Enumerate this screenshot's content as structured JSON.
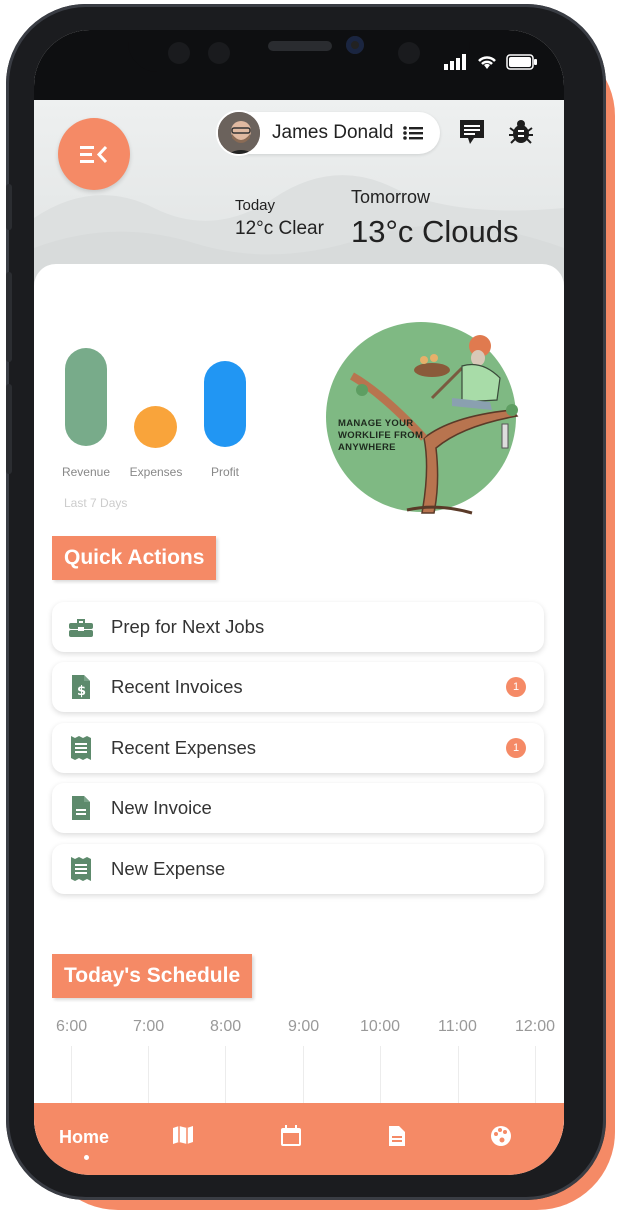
{
  "header": {
    "user_name": "James Donald",
    "weather_today_label": "Today",
    "weather_today_value": "12°c  Clear",
    "weather_tomorrow_label": "Tomorrow",
    "weather_tomorrow_value": "13°c Clouds"
  },
  "stats": {
    "revenue_label": "Revenue",
    "expenses_label": "Expenses",
    "profit_label": "Profit",
    "period": "Last 7 Days",
    "colors": {
      "revenue": "#78ab8a",
      "expenses": "#f9a43b",
      "profit": "#2196f3"
    }
  },
  "promo": {
    "text": "MANAGE YOUR WORKLIFE FROM ANYWHERE"
  },
  "quick_actions": {
    "title": "Quick Actions",
    "items": [
      {
        "label": "Prep for Next Jobs",
        "icon": "toolbox-icon",
        "badge": ""
      },
      {
        "label": "Recent Invoices",
        "icon": "invoice-dollar-icon",
        "badge": "1"
      },
      {
        "label": "Recent Expenses",
        "icon": "receipt-icon",
        "badge": "1"
      },
      {
        "label": "New Invoice",
        "icon": "document-icon",
        "badge": ""
      },
      {
        "label": "New Expense",
        "icon": "receipt-icon",
        "badge": ""
      }
    ]
  },
  "schedule": {
    "title": "Today's Schedule",
    "times": [
      "6:00",
      "7:00",
      "8:00",
      "9:00",
      "10:00",
      "11:00",
      "12:00"
    ]
  },
  "nav": {
    "home_label": "Home",
    "items": [
      "map-icon",
      "calendar-icon",
      "file-icon",
      "palette-icon"
    ]
  },
  "theme": {
    "accent": "#f58a66",
    "icon_green": "#5d8a6c"
  }
}
